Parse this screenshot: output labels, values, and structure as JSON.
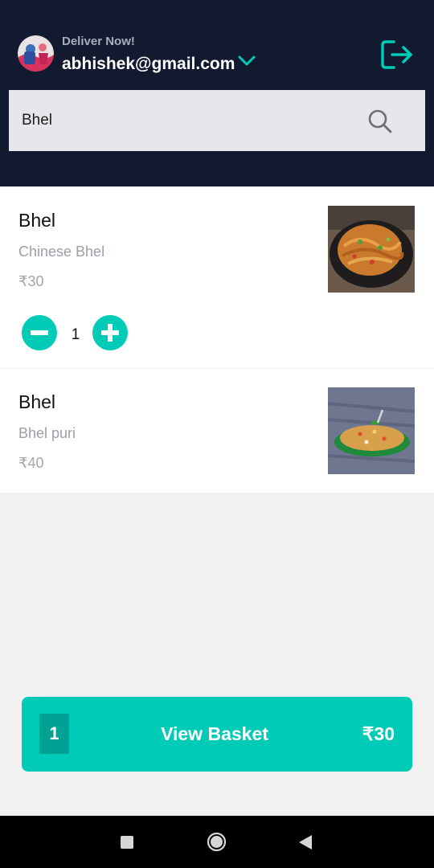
{
  "header": {
    "deliver_label": "Deliver Now!",
    "email": "abhishek@gmail.com",
    "avatar_icon": "user-avatar",
    "dropdown_icon": "chevron-down-icon",
    "logout_icon": "logout-icon"
  },
  "search": {
    "value": "Bhel",
    "icon": "search-icon"
  },
  "items": [
    {
      "name": "Bhel",
      "description": "Chinese Bhel",
      "price": "₹30",
      "quantity": "1",
      "image": "noodles-photo"
    },
    {
      "name": "Bhel",
      "description": "Bhel puri",
      "price": "₹40",
      "image": "bhel-puri-photo"
    }
  ],
  "basket": {
    "count": "1",
    "label": "View Basket",
    "total": "₹30"
  },
  "colors": {
    "header_bg": "#111a2f",
    "accent": "#00cbb6",
    "accent_dark": "#00a293"
  }
}
